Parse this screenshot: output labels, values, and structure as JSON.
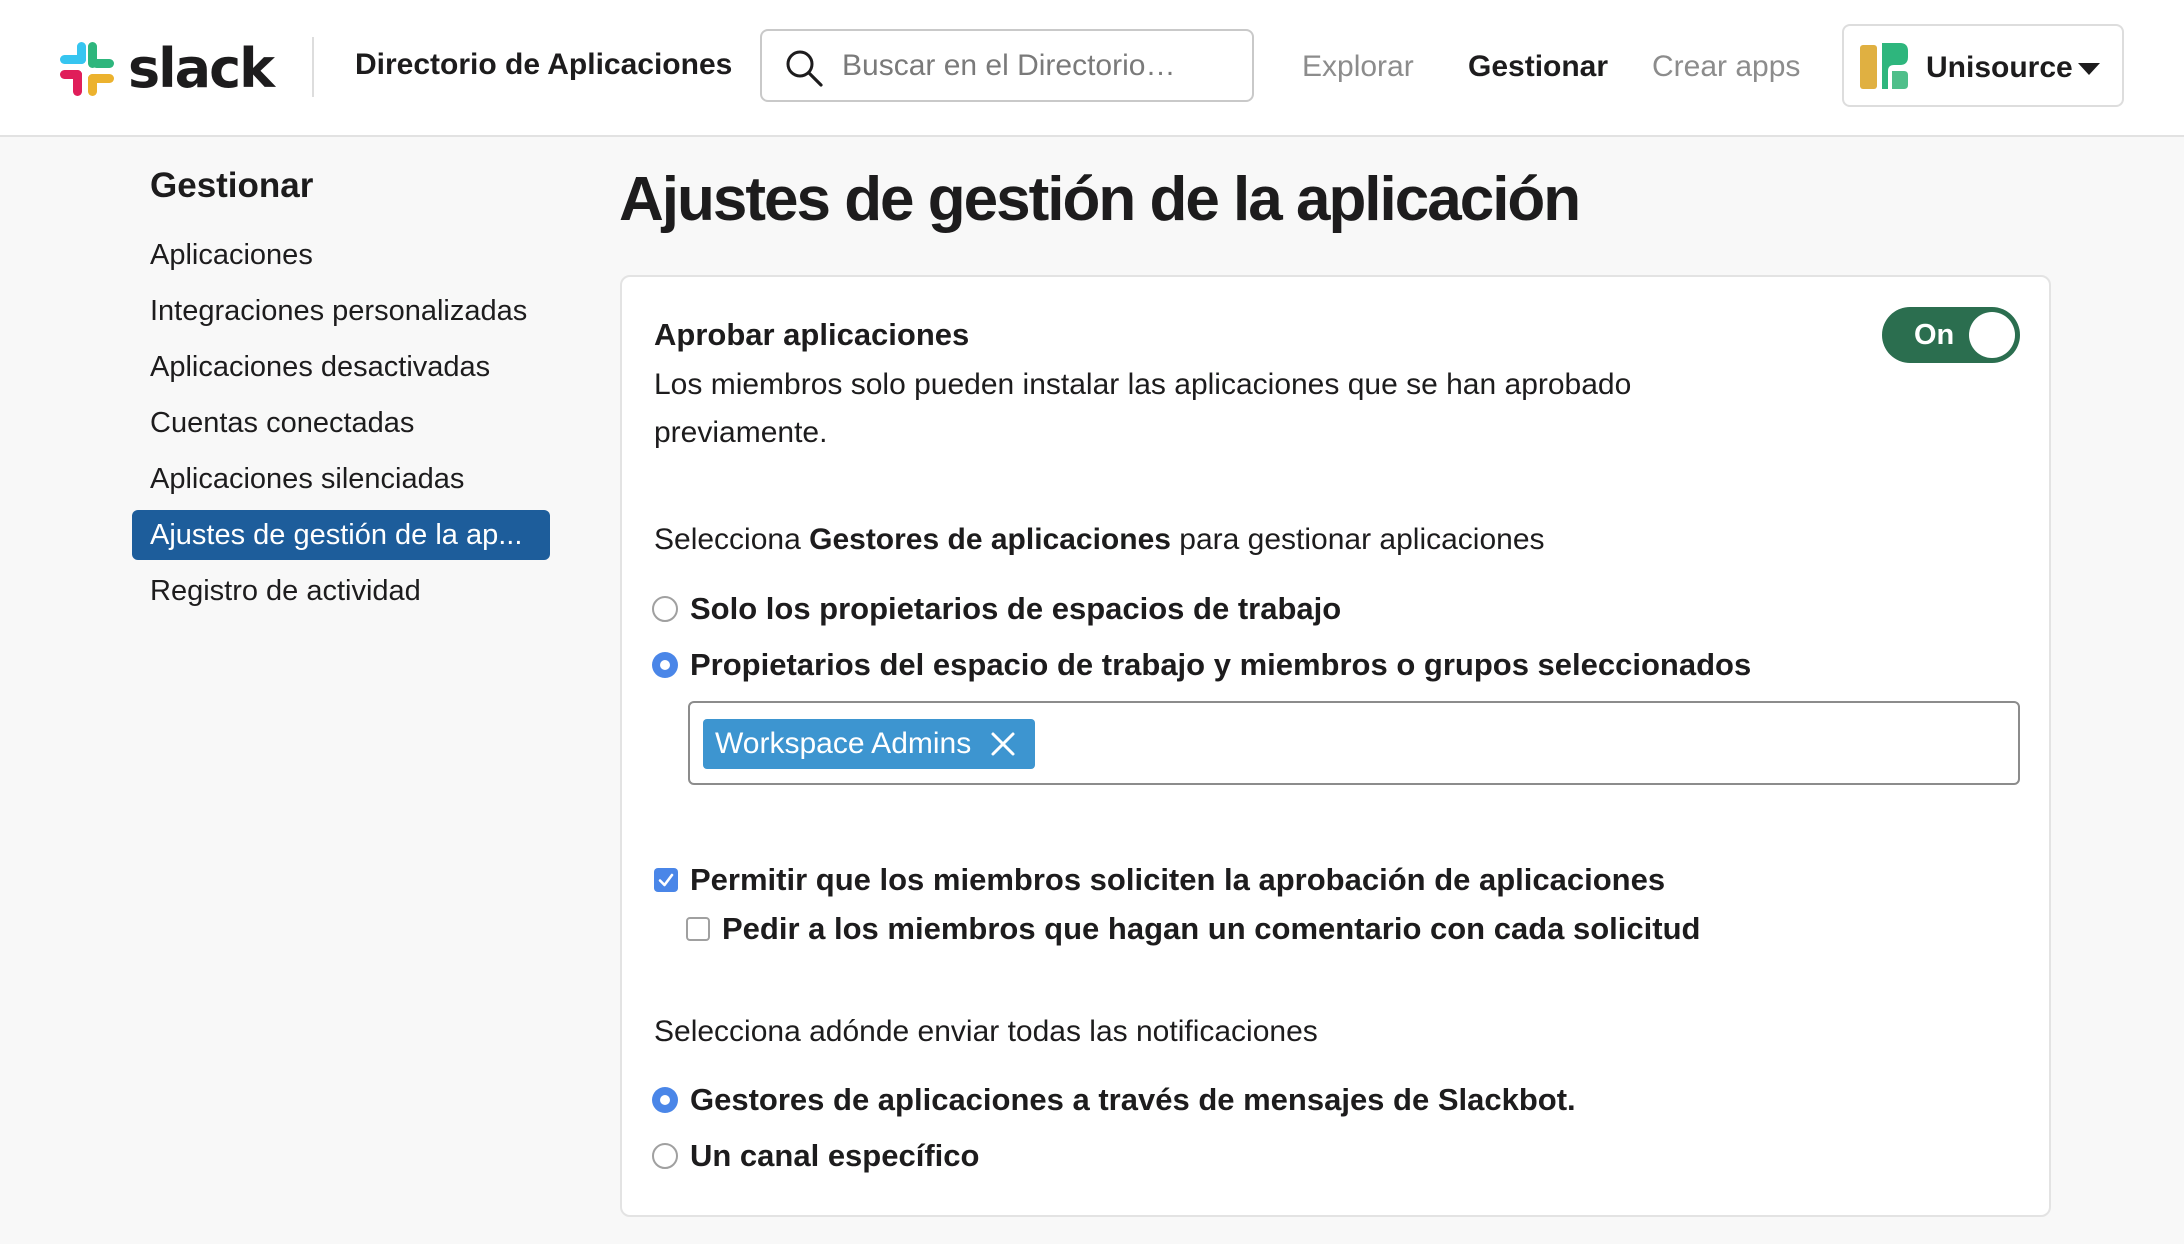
{
  "header": {
    "logo_text": "slack",
    "directory_title": "Directorio de Aplicaciones",
    "search_placeholder": "Buscar en el Directorio…",
    "nav": [
      {
        "label": "Explorar",
        "active": false
      },
      {
        "label": "Gestionar",
        "active": true
      },
      {
        "label": "Crear apps",
        "active": false
      }
    ],
    "workspace_name": "Unisource"
  },
  "sidebar": {
    "title": "Gestionar",
    "items": [
      {
        "label": "Aplicaciones",
        "active": false
      },
      {
        "label": "Integraciones personalizadas",
        "active": false
      },
      {
        "label": "Aplicaciones desactivadas",
        "active": false
      },
      {
        "label": "Cuentas conectadas",
        "active": false
      },
      {
        "label": "Aplicaciones silenciadas",
        "active": false
      },
      {
        "label": "Ajustes de gestión de la ap...",
        "active": true
      },
      {
        "label": "Registro de actividad",
        "active": false
      }
    ]
  },
  "main": {
    "page_title": "Ajustes de gestión de la aplicación",
    "approve": {
      "title": "Aprobar aplicaciones",
      "description": "Los miembros solo pueden instalar las aplicaciones que se han aprobado previamente.",
      "toggle_label": "On",
      "toggle_on": true
    },
    "managers": {
      "label_prefix": "Selecciona ",
      "label_bold": "Gestores de aplicaciones",
      "label_suffix": " para gestionar aplicaciones",
      "options": [
        {
          "label": "Solo los propietarios de espacios de trabajo",
          "checked": false
        },
        {
          "label": "Propietarios del espacio de trabajo y miembros o grupos seleccionados",
          "checked": true
        }
      ],
      "selected_tag": "Workspace Admins"
    },
    "requests": {
      "allow_label": "Permitir que los miembros soliciten la aprobación de aplicaciones",
      "allow_checked": true,
      "comment_label": "Pedir a los miembros que hagan un comentario con cada solicitud",
      "comment_checked": false
    },
    "notifications": {
      "label": "Selecciona adónde enviar todas las notificaciones",
      "options": [
        {
          "label": "Gestores de aplicaciones a través de mensajes de Slackbot.",
          "checked": true
        },
        {
          "label": "Un canal específico",
          "checked": false
        }
      ]
    }
  },
  "colors": {
    "toggle_on": "#2b6e4f",
    "sidebar_active": "#1d5d9b",
    "radio_checked": "#4a86e8",
    "tag_bg": "#3d95d0"
  }
}
